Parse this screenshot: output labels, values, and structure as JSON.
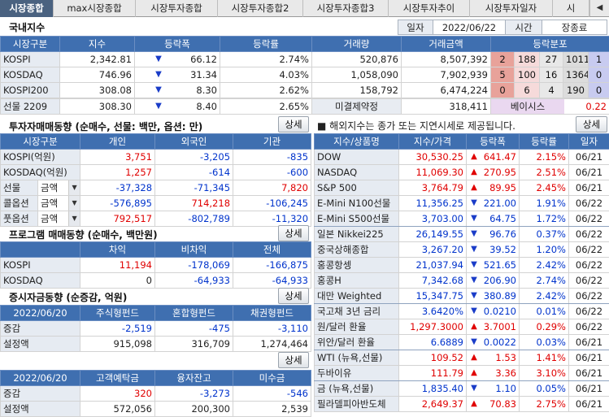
{
  "tabs": [
    "시장종합",
    "max시장종합",
    "시장투자종합",
    "시장투자종합2",
    "시장투자종합3",
    "시장투자추이",
    "시장투자일자",
    "시"
  ],
  "domestic": {
    "title": "국내지수",
    "date_label": "일자",
    "date": "2022/06/22",
    "time_label": "시간",
    "time": "장종료",
    "headers": [
      "시장구분",
      "지수",
      "등락폭",
      "등락률",
      "거래량",
      "거래금액",
      "등락분포"
    ],
    "rows": [
      {
        "name": "KOSPI",
        "index": "2,342.81",
        "dir": "down",
        "change": "66.12",
        "rate": "2.74%",
        "volume": "520,876",
        "amount": "8,507,392",
        "d1": "2",
        "d2": "188",
        "d3": "27",
        "d4": "1011",
        "d5": "1"
      },
      {
        "name": "KOSDAQ",
        "index": "746.96",
        "dir": "down",
        "change": "31.34",
        "rate": "4.03%",
        "volume": "1,058,090",
        "amount": "7,902,939",
        "d1": "5",
        "d2": "100",
        "d3": "16",
        "d4": "1364",
        "d5": "0"
      },
      {
        "name": "KOSPI200",
        "index": "308.08",
        "dir": "down",
        "change": "8.30",
        "rate": "2.62%",
        "volume": "158,792",
        "amount": "6,474,224",
        "d1": "0",
        "d2": "6",
        "d3": "4",
        "d4": "190",
        "d5": "0"
      }
    ],
    "futures": {
      "name": "선물 2209",
      "index": "308.30",
      "dir": "down",
      "change": "8.40",
      "rate": "2.65%",
      "oi_label": "미결제약정",
      "oi": "318,411",
      "basis_label": "베이시스",
      "basis": "0.22"
    }
  },
  "investor": {
    "title": "투자자매매동향 (순매수, 선물: 백만, 옵션: 만)",
    "detail": "상세",
    "headers": [
      "시장구분",
      "개인",
      "외국인",
      "기관"
    ],
    "rows": [
      {
        "name": "KOSPI(억원)",
        "sel": "",
        "v1": "3,751",
        "v2": "-3,205",
        "v3": "-835"
      },
      {
        "name": "KOSDAQ(억원)",
        "sel": "",
        "v1": "1,257",
        "v2": "-614",
        "v3": "-600"
      },
      {
        "name": "선물",
        "sel": "금액",
        "v1": "-37,328",
        "v2": "-71,345",
        "v3": "7,820"
      },
      {
        "name": "콜옵션",
        "sel": "금액",
        "v1": "-576,895",
        "v2": "714,218",
        "v3": "-106,245"
      },
      {
        "name": "풋옵션",
        "sel": "금액",
        "v1": "792,517",
        "v2": "-802,789",
        "v3": "-11,320"
      }
    ]
  },
  "program": {
    "title": "프로그램 매매동향 (순매수, 백만원)",
    "detail": "상세",
    "headers": [
      "",
      "차익",
      "비차익",
      "전체"
    ],
    "rows": [
      {
        "name": "KOSPI",
        "v1": "11,194",
        "v2": "-178,069",
        "v3": "-166,875"
      },
      {
        "name": "KOSDAQ",
        "v1": "0",
        "v2": "-64,933",
        "v3": "-64,933"
      }
    ]
  },
  "funds": {
    "title": "증시자금동향 (순증감, 억원)",
    "detail": "상세",
    "headers": [
      "2022/06/20",
      "주식형펀드",
      "혼합형펀드",
      "채권형펀드"
    ],
    "rows": [
      {
        "name": "증감",
        "v1": "-2,519",
        "v2": "-475",
        "v3": "-3,110"
      },
      {
        "name": "설정액",
        "v1": "915,098",
        "v2": "316,709",
        "v3": "1,274,464"
      }
    ]
  },
  "deposits": {
    "detail": "상세",
    "headers": [
      "2022/06/20",
      "고객예탁금",
      "융자잔고",
      "미수금"
    ],
    "rows": [
      {
        "name": "증감",
        "v1": "320",
        "v2": "-3,273",
        "v3": "-546"
      },
      {
        "name": "설정액",
        "v1": "572,056",
        "v2": "200,300",
        "v3": "2,539"
      }
    ]
  },
  "overseas": {
    "notice": "■ 해외지수는 종가 또는 지연시세로 제공됩니다.",
    "detail": "상세",
    "headers": [
      "지수/상품명",
      "지수/가격",
      "등락폭",
      "등락률",
      "일자"
    ],
    "rows": [
      {
        "name": "DOW",
        "price": "30,530.25",
        "dir": "up",
        "change": "641.47",
        "rate": "2.15%",
        "date": "06/21"
      },
      {
        "name": "NASDAQ",
        "price": "11,069.30",
        "dir": "up",
        "change": "270.95",
        "rate": "2.51%",
        "date": "06/21"
      },
      {
        "name": "S&P 500",
        "price": "3,764.79",
        "dir": "up",
        "change": "89.95",
        "rate": "2.45%",
        "date": "06/21"
      },
      {
        "name": "E-Mini N100선물",
        "price": "11,356.25",
        "dir": "down",
        "change": "221.00",
        "rate": "1.91%",
        "date": "06/22"
      },
      {
        "name": "E-Mini S500선물",
        "price": "3,703.00",
        "dir": "down",
        "change": "64.75",
        "rate": "1.72%",
        "date": "06/22"
      },
      {
        "name": "일본 Nikkei225",
        "price": "26,149.55",
        "dir": "down",
        "change": "96.76",
        "rate": "0.37%",
        "date": "06/22"
      },
      {
        "name": "중국상해종합",
        "price": "3,267.20",
        "dir": "down",
        "change": "39.52",
        "rate": "1.20%",
        "date": "06/22"
      },
      {
        "name": "홍콩항셍",
        "price": "21,037.94",
        "dir": "down",
        "change": "521.65",
        "rate": "2.42%",
        "date": "06/22"
      },
      {
        "name": "홍콩H",
        "price": "7,342.68",
        "dir": "down",
        "change": "206.90",
        "rate": "2.74%",
        "date": "06/22"
      },
      {
        "name": "대만 Weighted",
        "price": "15,347.75",
        "dir": "down",
        "change": "380.89",
        "rate": "2.42%",
        "date": "06/22"
      },
      {
        "name": "국고채 3년 금리",
        "price": "3.6420%",
        "dir": "down",
        "change": "0.0210",
        "rate": "0.01%",
        "date": "06/22"
      },
      {
        "name": "원/달러 환율",
        "price": "1,297.3000",
        "dir": "up",
        "change": "3.7001",
        "rate": "0.29%",
        "date": "06/22"
      },
      {
        "name": "위안/달러 환율",
        "price": "6.6889",
        "dir": "down",
        "change": "0.0022",
        "rate": "0.03%",
        "date": "06/21"
      },
      {
        "name": "WTI (뉴욕,선물)",
        "price": "109.52",
        "dir": "up",
        "change": "1.53",
        "rate": "1.41%",
        "date": "06/21"
      },
      {
        "name": "두바이유",
        "price": "111.79",
        "dir": "up",
        "change": "3.36",
        "rate": "3.10%",
        "date": "06/21"
      },
      {
        "name": "금 (뉴욕,선물)",
        "price": "1,835.40",
        "dir": "down",
        "change": "1.10",
        "rate": "0.05%",
        "date": "06/21"
      },
      {
        "name": "필라델피아반도체",
        "price": "2,649.37",
        "dir": "up",
        "change": "70.83",
        "rate": "2.75%",
        "date": "06/21"
      }
    ]
  }
}
